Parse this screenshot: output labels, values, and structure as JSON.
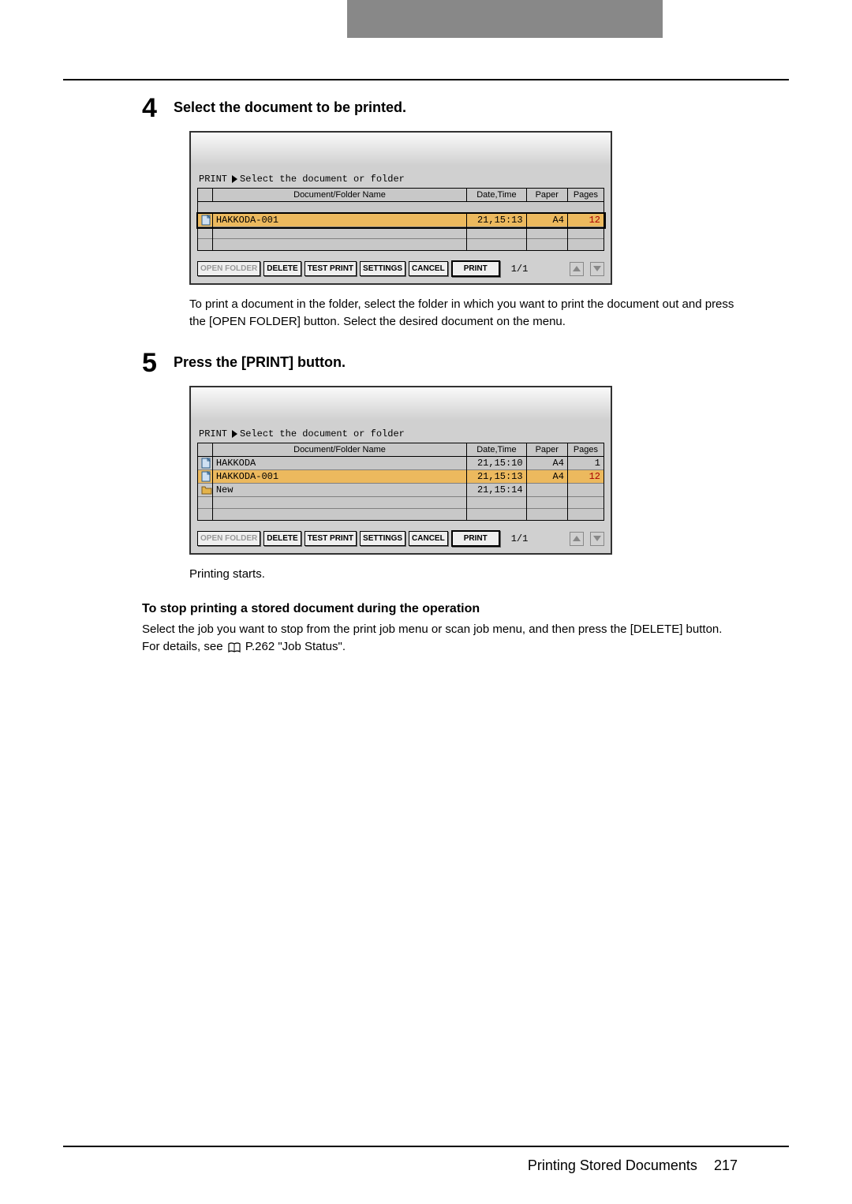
{
  "step4": {
    "title": "Select the document to be printed.",
    "afterText": "To print a document in the folder, select the folder in which you want to print the document out and press the [OPEN FOLDER] button. Select the desired document on the menu."
  },
  "step5": {
    "title": "Press the [PRINT] button.",
    "afterText": "Printing starts."
  },
  "subhead": "To stop printing a stored document during the operation",
  "subtext_a": "Select the job you want to stop from the print job menu or scan job menu, and then press the [DELETE] button. For details, see ",
  "subtext_b": " P.262 \"Job Status\".",
  "panel": {
    "titleLabel": "PRINT",
    "caption": "Select the document or folder",
    "headers": {
      "name": "Document/Folder Name",
      "dt": "Date,Time",
      "paper": "Paper",
      "pages": "Pages"
    },
    "buttons": {
      "openFolder": "OPEN FOLDER",
      "delete": "DELETE",
      "testPrint": "TEST PRINT",
      "settings": "SETTINGS",
      "cancel": "CANCEL",
      "print": "PRINT"
    },
    "pageIndicator": "1/1"
  },
  "panel1_rows": [
    {
      "icon": "file",
      "name": "HAKKODA-001",
      "dt": "21,15:13",
      "paper": "A4",
      "pages": "12",
      "selected": true
    }
  ],
  "panel2_rows": [
    {
      "icon": "file",
      "name": "HAKKODA",
      "dt": "21,15:10",
      "paper": "A4",
      "pages": "1",
      "selected": false
    },
    {
      "icon": "file",
      "name": "HAKKODA-001",
      "dt": "21,15:13",
      "paper": "A4",
      "pages": "12",
      "selected": true
    },
    {
      "icon": "folder",
      "name": "New",
      "dt": "21,15:14",
      "paper": "",
      "pages": "",
      "selected": false
    }
  ],
  "footer": {
    "title": "Printing Stored Documents",
    "page": "217"
  }
}
